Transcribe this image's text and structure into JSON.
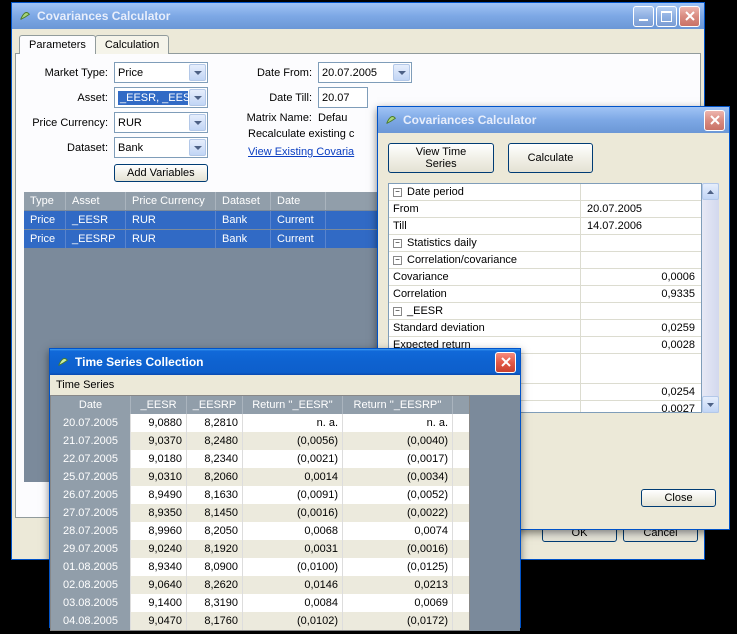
{
  "main_window": {
    "title": "Covariances Calculator",
    "tabs": {
      "parameters": "Parameters",
      "calculation": "Calculation"
    },
    "labels": {
      "market_type": "Market Type:",
      "asset": "Asset:",
      "price_currency": "Price Currency:",
      "dataset": "Dataset:",
      "date_from": "Date From:",
      "date_till": "Date Till:",
      "matrix_name": "Matrix Name:"
    },
    "values": {
      "market_type": "Price",
      "asset": "_EESR, _EESRP",
      "price_currency": "RUR",
      "dataset": "Bank",
      "date_from": "20.07.2005",
      "date_till": "20.07",
      "matrix_name": "Defau"
    },
    "recalc_label": "Recalculate existing c",
    "add_variables": "Add Variables",
    "view_existing": "View Existing Covaria",
    "grid_headers": {
      "type": "Type",
      "asset": "Asset",
      "pc": "Price Currency",
      "dataset": "Dataset",
      "date": "Date"
    },
    "grid_rows": [
      {
        "type": "Price",
        "asset": "_EESR",
        "pc": "RUR",
        "dataset": "Bank",
        "date": "Current"
      },
      {
        "type": "Price",
        "asset": "_EESRP",
        "pc": "RUR",
        "dataset": "Bank",
        "date": "Current"
      }
    ],
    "buttons": {
      "ok": "OK",
      "cancel": "Cancel"
    }
  },
  "cov_dialog": {
    "title": "Covariances Calculator",
    "buttons": {
      "view_ts": "View Time Series",
      "calculate": "Calculate",
      "close": "Close"
    },
    "tree": {
      "date_period": "Date period",
      "from": "From",
      "from_val": "20.07.2005",
      "till": "Till",
      "till_val": "14.07.2006",
      "stats": "Statistics daily",
      "corrcov": "Correlation/covariance",
      "covariance": "Covariance",
      "covariance_val": "0,0006",
      "correlation": "Correlation",
      "correlation_val": "0,9335",
      "eesr": "_EESR",
      "stddev": "Standard deviation",
      "stddev_val": "0,0259",
      "expret": "Expected return",
      "expret_val": "0,0028",
      "val_a": "0,0254",
      "val_b": "0,0027"
    }
  },
  "ts_window": {
    "title": "Time Series Collection",
    "subtitle": "Time Series",
    "headers": {
      "date": "Date",
      "eesr": "_EESR",
      "eesrp": "_EESRP",
      "ret_eesr": "Return ''_EESR''",
      "ret_eesrp": "Return ''_EESRP''"
    },
    "rows": [
      {
        "date": "20.07.2005",
        "eesr": "9,0880",
        "eesrp": "8,2810",
        "r1": "n. a.",
        "r2": "n. a."
      },
      {
        "date": "21.07.2005",
        "eesr": "9,0370",
        "eesrp": "8,2480",
        "r1": "(0,0056)",
        "r2": "(0,0040)"
      },
      {
        "date": "22.07.2005",
        "eesr": "9,0180",
        "eesrp": "8,2340",
        "r1": "(0,0021)",
        "r2": "(0,0017)"
      },
      {
        "date": "25.07.2005",
        "eesr": "9,0310",
        "eesrp": "8,2060",
        "r1": "0,0014",
        "r2": "(0,0034)"
      },
      {
        "date": "26.07.2005",
        "eesr": "8,9490",
        "eesrp": "8,1630",
        "r1": "(0,0091)",
        "r2": "(0,0052)"
      },
      {
        "date": "27.07.2005",
        "eesr": "8,9350",
        "eesrp": "8,1450",
        "r1": "(0,0016)",
        "r2": "(0,0022)"
      },
      {
        "date": "28.07.2005",
        "eesr": "8,9960",
        "eesrp": "8,2050",
        "r1": "0,0068",
        "r2": "0,0074"
      },
      {
        "date": "29.07.2005",
        "eesr": "9,0240",
        "eesrp": "8,1920",
        "r1": "0,0031",
        "r2": "(0,0016)"
      },
      {
        "date": "01.08.2005",
        "eesr": "8,9340",
        "eesrp": "8,0900",
        "r1": "(0,0100)",
        "r2": "(0,0125)"
      },
      {
        "date": "02.08.2005",
        "eesr": "9,0640",
        "eesrp": "8,2620",
        "r1": "0,0146",
        "r2": "0,0213"
      },
      {
        "date": "03.08.2005",
        "eesr": "9,1400",
        "eesrp": "8,3190",
        "r1": "0,0084",
        "r2": "0,0069"
      },
      {
        "date": "04.08.2005",
        "eesr": "9,0470",
        "eesrp": "8,1760",
        "r1": "(0,0102)",
        "r2": "(0,0172)"
      }
    ]
  },
  "chart_data": {
    "type": "table",
    "title": "Time Series Collection",
    "columns": [
      "Date",
      "_EESR",
      "_EESRP",
      "Return ''_EESR''",
      "Return ''_EESRP''"
    ],
    "rows": [
      [
        "20.07.2005",
        9.088,
        8.281,
        null,
        null
      ],
      [
        "21.07.2005",
        9.037,
        8.248,
        -0.0056,
        -0.004
      ],
      [
        "22.07.2005",
        9.018,
        8.234,
        -0.0021,
        -0.0017
      ],
      [
        "25.07.2005",
        9.031,
        8.206,
        0.0014,
        -0.0034
      ],
      [
        "26.07.2005",
        8.949,
        8.163,
        -0.0091,
        -0.0052
      ],
      [
        "27.07.2005",
        8.935,
        8.145,
        -0.0016,
        -0.0022
      ],
      [
        "28.07.2005",
        8.996,
        8.205,
        0.0068,
        0.0074
      ],
      [
        "29.07.2005",
        9.024,
        8.192,
        0.0031,
        -0.0016
      ],
      [
        "01.08.2005",
        8.934,
        8.09,
        -0.01,
        -0.0125
      ],
      [
        "02.08.2005",
        9.064,
        8.262,
        0.0146,
        0.0213
      ],
      [
        "03.08.2005",
        9.14,
        8.319,
        0.0084,
        0.0069
      ],
      [
        "04.08.2005",
        9.047,
        8.176,
        -0.0102,
        -0.0172
      ]
    ],
    "statistics": {
      "date_from": "20.07.2005",
      "date_till": "14.07.2006",
      "covariance": 0.0006,
      "correlation": 0.9335,
      "_EESR": {
        "std_dev": 0.0259,
        "expected_return": 0.0028
      },
      "extra_values": [
        0.0254,
        0.0027
      ]
    }
  },
  "colors": {
    "accent": "#316ac5",
    "title": "#0e62d0",
    "close": "#e35a47",
    "bg": "#ece9d8"
  }
}
